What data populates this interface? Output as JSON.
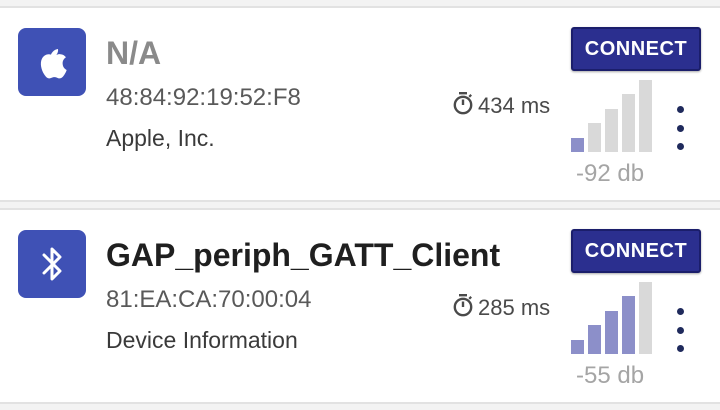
{
  "devices": [
    {
      "icon": "apple-icon",
      "name": "N/A",
      "mac": "48:84:92:19:52:F8",
      "detail": "Apple, Inc.",
      "interval": "434 ms",
      "connect_label": "CONNECT",
      "rssi": "-92 db",
      "signal_level": 1,
      "signal_max": 5
    },
    {
      "icon": "bluetooth-icon",
      "name": "GAP_periph_GATT_Client",
      "mac": "81:EA:CA:70:00:04",
      "detail": "Device Information",
      "interval": "285 ms",
      "connect_label": "CONNECT",
      "rssi": "-55 db",
      "signal_level": 4,
      "signal_max": 5
    }
  ],
  "colors": {
    "accent": "#3f51b5",
    "button": "#2b2f8f",
    "signal_on": "#8c8fc9",
    "signal_off": "#d9d9d9"
  }
}
